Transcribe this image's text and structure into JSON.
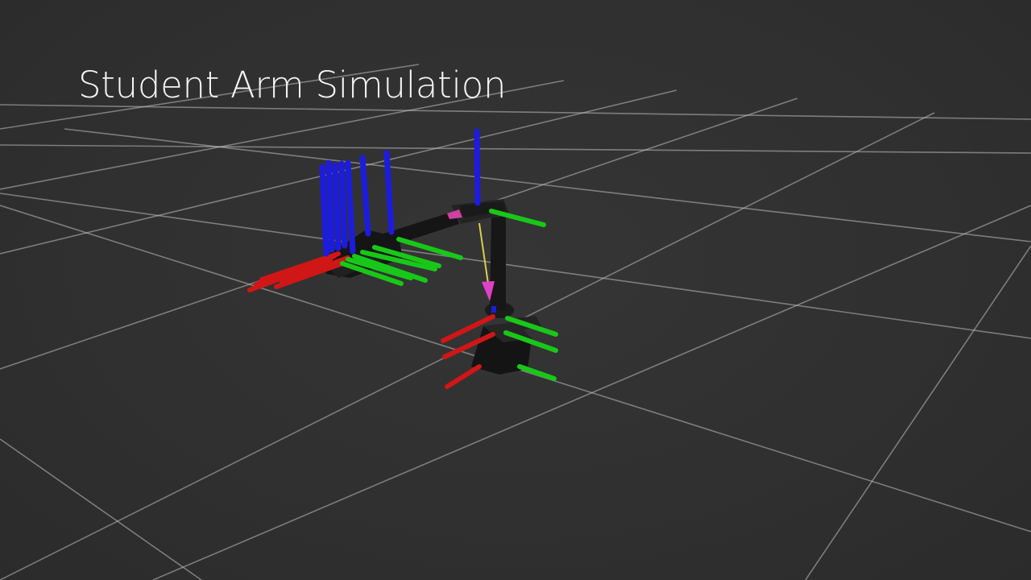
{
  "slide": {
    "title": "Student Arm Simulation"
  },
  "scene": {
    "background_color": "#2f2f2f",
    "grid_color": "#bdbdbd",
    "axis_colors": {
      "x": "#d01616",
      "y": "#18c818",
      "z": "#1c1ce0"
    },
    "link_color": "#1a1a1a",
    "arrow_line_color": "#d8d04a",
    "arrow_head_color": "#e040c8"
  }
}
